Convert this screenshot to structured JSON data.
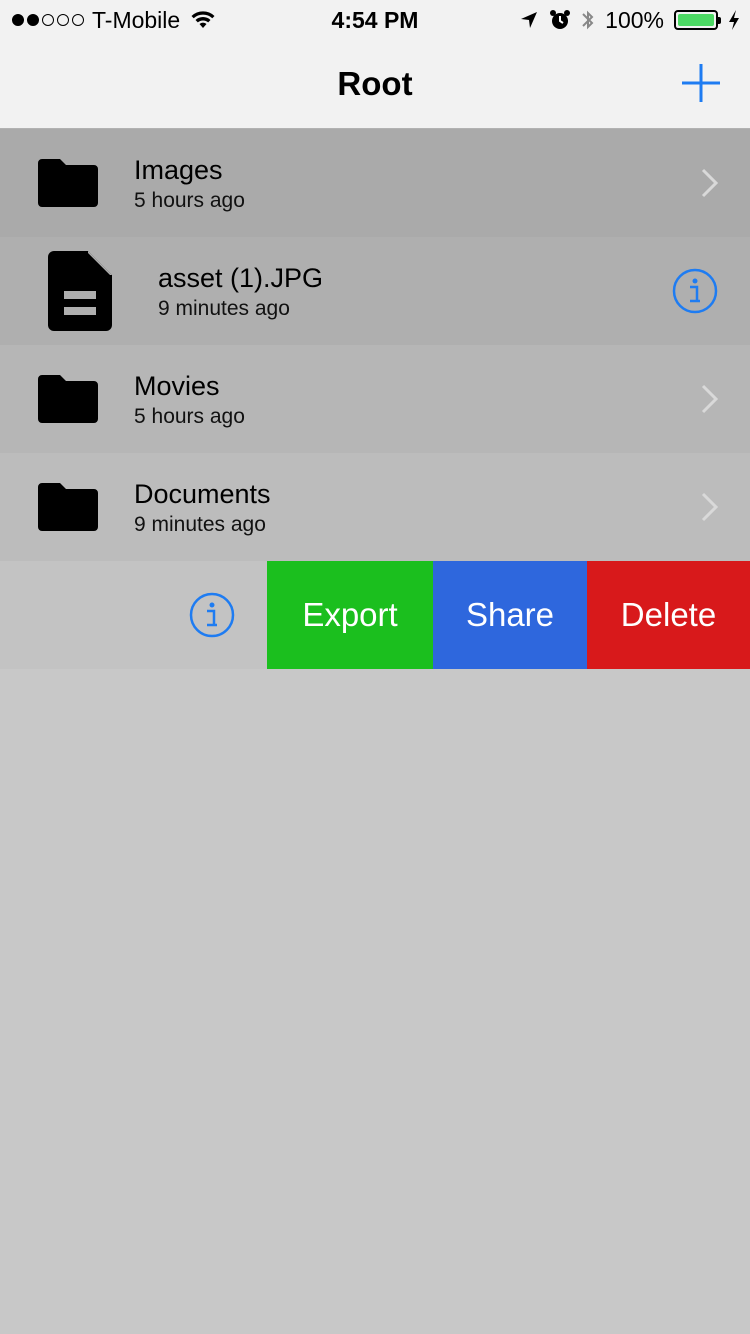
{
  "status_bar": {
    "carrier": "T-Mobile",
    "time": "4:54 PM",
    "battery": "100%",
    "signal_bars_filled": 2,
    "signal_bars_total": 5
  },
  "nav": {
    "title": "Root",
    "add_icon": "plus-icon"
  },
  "items": [
    {
      "name": "Images",
      "subtitle": "5 hours ago",
      "type": "folder",
      "accessory": "chevron",
      "bg": "#aaaaaa"
    },
    {
      "name": "asset (1).JPG",
      "subtitle": "9 minutes ago",
      "type": "file",
      "accessory": "info",
      "bg": "#afafaf"
    },
    {
      "name": "Movies",
      "subtitle": "5 hours ago",
      "type": "folder",
      "accessory": "chevron",
      "bg": "#b6b6b6"
    },
    {
      "name": "Documents",
      "subtitle": "9 minutes ago",
      "type": "folder",
      "accessory": "chevron",
      "bg": "#bcbcbc"
    }
  ],
  "swiped_row": {
    "bg": "#c3c3c3",
    "actions": [
      {
        "label": "Export",
        "color": "#1bbf1e"
      },
      {
        "label": "Share",
        "color": "#2e67dd"
      },
      {
        "label": "Delete",
        "color": "#d8191b"
      }
    ]
  },
  "colors": {
    "tint": "#1e7cf2",
    "chevron": "#d9d9d9"
  }
}
